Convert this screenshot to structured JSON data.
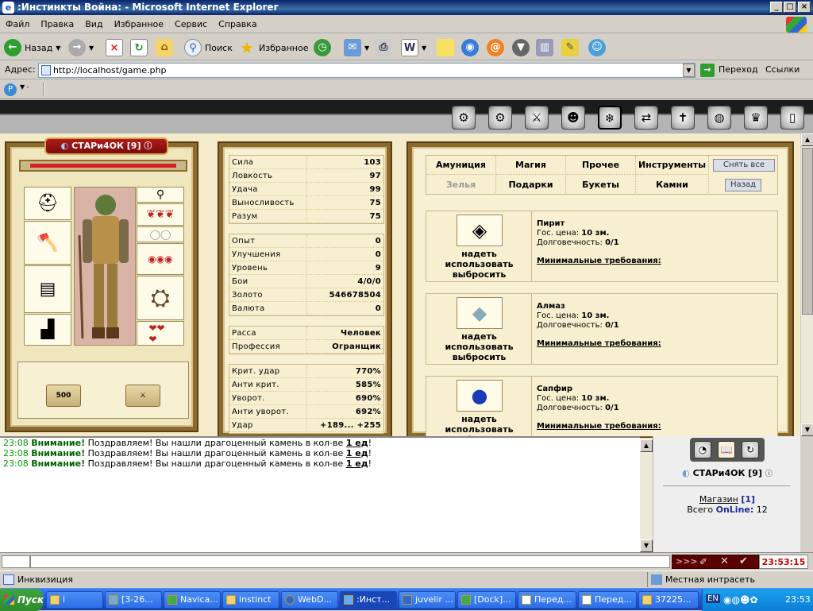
{
  "window": {
    "title": ":Инстинкты Война: - Microsoft Internet Explorer"
  },
  "menu": [
    "Файл",
    "Правка",
    "Вид",
    "Избранное",
    "Сервис",
    "Справка"
  ],
  "toolbar": {
    "back": "Назад",
    "search": "Поиск",
    "favorites": "Избранное"
  },
  "address": {
    "label": "Адрес:",
    "url": "http://localhost/game.php",
    "go": "Переход",
    "links": "Ссылки"
  },
  "character": {
    "name": "СТАРи4ОК [9]",
    "scroll1": "500",
    "slots": [
      "helmet-icon",
      "axe-icon",
      "armor-icon",
      "boots-icon",
      "amulet-icon",
      "belt-icon",
      "ring-icon",
      "shield-icon",
      "bracer-icon"
    ]
  },
  "stats": {
    "group1": [
      {
        "label": "Сила",
        "value": "103"
      },
      {
        "label": "Ловкость",
        "value": "97"
      },
      {
        "label": "Удача",
        "value": "99"
      },
      {
        "label": "Выносливость",
        "value": "75"
      },
      {
        "label": "Разум",
        "value": "75"
      }
    ],
    "group2": [
      {
        "label": "Опыт",
        "value": "0"
      },
      {
        "label": "Улучшения",
        "value": "0"
      },
      {
        "label": "Уровень",
        "value": "9"
      },
      {
        "label": "Бои",
        "value": "4/0/0"
      },
      {
        "label": "Золото",
        "value": "546678504"
      },
      {
        "label": "Валюта",
        "value": "0"
      }
    ],
    "group3": [
      {
        "label": "Расса",
        "value": "Человек"
      },
      {
        "label": "Профессия",
        "value": "Огранщик"
      }
    ],
    "group4": [
      {
        "label": "Крит. удар",
        "value": "770%"
      },
      {
        "label": "Анти крит.",
        "value": "585%"
      },
      {
        "label": "Уворот.",
        "value": "690%"
      },
      {
        "label": "Анти уворот.",
        "value": "692%"
      },
      {
        "label": "Удар",
        "value": "+189... +255"
      }
    ]
  },
  "inventory": {
    "tabs_row1": [
      "Амуниция",
      "Магия",
      "Прочее",
      "Инструменты"
    ],
    "tabs_row2": [
      "Зелья",
      "Подарки",
      "Букеты",
      "Камни"
    ],
    "remove_all": "Снять все",
    "back": "Назад",
    "actions": {
      "wear": "надеть",
      "use": "использовать",
      "drop": "выбросить"
    },
    "labels": {
      "price": "Гос. цена:",
      "durability": "Долговечность:",
      "requirements": "Минимальные требования:"
    },
    "items": [
      {
        "name": "Пирит",
        "price": "10 зм.",
        "durability": "0/1",
        "icon": "pyrite-icon"
      },
      {
        "name": "Алмаз",
        "price": "10 зм.",
        "durability": "0/1",
        "icon": "diamond-icon"
      },
      {
        "name": "Сапфир",
        "price": "10 зм.",
        "durability": "0/1",
        "icon": "sapphire-icon"
      }
    ]
  },
  "chat": {
    "messages": [
      {
        "time": "23:08",
        "warn": "Внимание!",
        "text": " Поздравляем! Вы нашли драгоценный камень в кол-ве ",
        "qty": "1 ед",
        "end": "!"
      },
      {
        "time": "23:08",
        "warn": "Внимание!",
        "text": " Поздравляем! Вы нашли драгоценный камень в кол-ве ",
        "qty": "1 ед",
        "end": "!"
      },
      {
        "time": "23:08",
        "warn": "Внимание!",
        "text": " Поздравляем! Вы нашли драгоценный камень в кол-ве ",
        "qty": "1 ед",
        "end": "!"
      }
    ]
  },
  "online": {
    "user": "СТАРи4ОК [9]",
    "shop": "Магазин",
    "shop_count": "[1]",
    "total": "Всего",
    "online_label": "OnLine:",
    "count": "12"
  },
  "clock": "23:53:15",
  "bar_arrows": ">>>",
  "status": {
    "left": "Инквизиция",
    "zone": "Местная интрасеть"
  },
  "taskbar": {
    "start": "Пуск",
    "time": "23:53",
    "tray_lang": "EN",
    "tasks": [
      "i",
      "[3-26...",
      "Navica...",
      "instinct",
      "WebD...",
      ":Инст...",
      "juvelir ...",
      "[Dock]...",
      "Перед...",
      "Перед...",
      "37225..."
    ]
  },
  "colors": {
    "accent": "#0a246a",
    "chat_time": "#00a000",
    "warn": "#006400",
    "clock": "#cc0000"
  }
}
